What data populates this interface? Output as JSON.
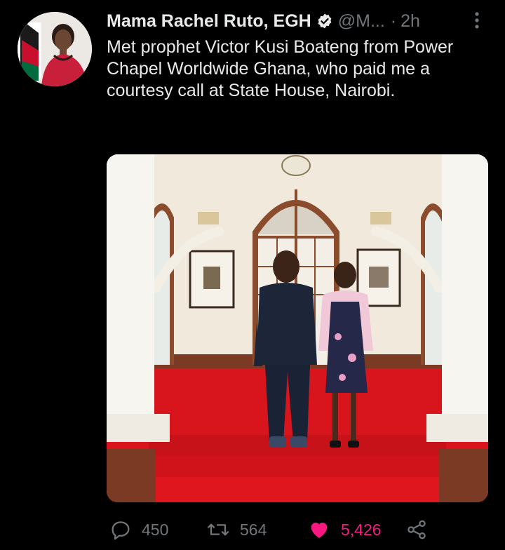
{
  "tweet": {
    "author_name": "Mama Rachel Ruto, EGH",
    "handle": "@M...",
    "separator": "·",
    "time": "2h",
    "text": "Met prophet Victor Kusi Boateng from Power Chapel Worldwide Ghana, who paid me a courtesy call at State House, Nairobi."
  },
  "actions": {
    "replies": "450",
    "retweets": "564",
    "likes": "5,426",
    "liked": true
  },
  "colors": {
    "background": "#000000",
    "text": "#e7e9ea",
    "muted": "#71767b",
    "like": "#f91880",
    "verified": "#e7e9ea"
  },
  "icons": [
    "verified-badge-icon",
    "more-options-icon",
    "reply-icon",
    "retweet-icon",
    "heart-icon",
    "share-icon"
  ]
}
